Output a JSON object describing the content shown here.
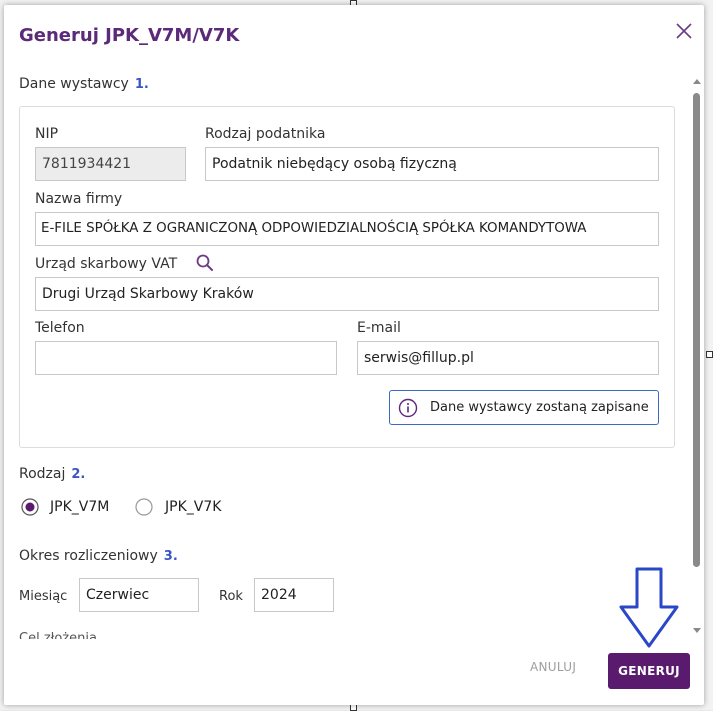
{
  "dialog": {
    "title": "Generuj JPK_V7M/V7K",
    "accent_color": "#5a1a6e",
    "number_color": "#3a55c4"
  },
  "section1": {
    "title": "Dane wystawcy",
    "num": "1.",
    "nip_label": "NIP",
    "nip_value": "7811934421",
    "taxpayer_type_label": "Rodzaj podatnika",
    "taxpayer_type_value": "Podatnik niebędący osobą fizyczną",
    "company_label": "Nazwa firmy",
    "company_value": "E-FILE SPÓŁKA Z OGRANICZONĄ ODPOWIEDZIALNOŚCIĄ SPÓŁKA KOMANDYTOWA",
    "tax_office_label": "Urząd skarbowy VAT",
    "tax_office_value": "Drugi Urząd Skarbowy Kraków",
    "phone_label": "Telefon",
    "phone_value": "",
    "email_label": "E-mail",
    "email_value": "serwis@fillup.pl",
    "info_text": "Dane wystawcy zostaną zapisane"
  },
  "section2": {
    "title": "Rodzaj",
    "num": "2.",
    "options": [
      {
        "label": "JPK_V7M",
        "selected": true
      },
      {
        "label": "JPK_V7K",
        "selected": false
      }
    ]
  },
  "section3": {
    "title": "Okres rozliczeniowy",
    "num": "3.",
    "month_label": "Miesiąc",
    "month_value": "Czerwiec",
    "year_label": "Rok",
    "year_value": "2024",
    "next_section_partial": "Cel złożenia"
  },
  "footer": {
    "cancel_label": "ANULUJ",
    "generate_label": "GENERUJ"
  },
  "icons": [
    "close-icon",
    "search-icon",
    "info-icon",
    "down-arrow-annotation-icon"
  ]
}
